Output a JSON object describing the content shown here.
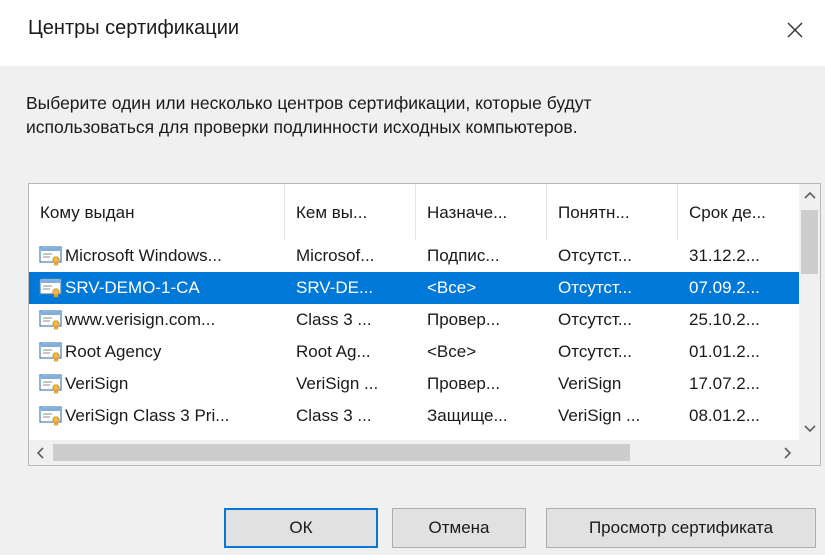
{
  "dialog": {
    "title": "Центры сертификации",
    "description_line1": "Выберите один или несколько центров сертификации, которые будут",
    "description_line2": "использоваться для проверки подлинности исходных компьютеров."
  },
  "table": {
    "columns": [
      "Кому выдан",
      "Кем вы...",
      "Назначе...",
      "Понятн...",
      "Срок де..."
    ],
    "rows": [
      {
        "cells": [
          "Microsoft Windows...",
          "Microsof...",
          "Подпис...",
          "Отсутст...",
          "31.12.2..."
        ],
        "selected": false
      },
      {
        "cells": [
          "SRV-DEMO-1-CA",
          "SRV-DE...",
          "<Все>",
          "Отсутст...",
          "07.09.2..."
        ],
        "selected": true
      },
      {
        "cells": [
          "www.verisign.com...",
          "Class 3 ...",
          "Провер...",
          "Отсутст...",
          "25.10.2..."
        ],
        "selected": false
      },
      {
        "cells": [
          "Root Agency",
          "Root Ag...",
          "<Все>",
          "Отсутст...",
          "01.01.2..."
        ],
        "selected": false
      },
      {
        "cells": [
          "VeriSign",
          "VeriSign ...",
          "Провер...",
          "VeriSign",
          "17.07.2..."
        ],
        "selected": false
      },
      {
        "cells": [
          "VeriSign Class 3 Pri...",
          "Class 3 ...",
          "Защище...",
          "VeriSign ...",
          "08.01.2..."
        ],
        "selected": false
      }
    ]
  },
  "buttons": {
    "ok": "ОК",
    "cancel": "Отмена",
    "view_certificate": "Просмотр сертификата"
  },
  "icons": {
    "close": "close-icon",
    "row": "certificate-icon",
    "scroll_up": "chevron-up-icon",
    "scroll_down": "chevron-down-icon",
    "scroll_left": "chevron-left-icon",
    "scroll_right": "chevron-right-icon"
  },
  "colors": {
    "selection": "#0078d7",
    "dialog_background": "#f0f0f0",
    "default_button_border": "#0078d7"
  }
}
